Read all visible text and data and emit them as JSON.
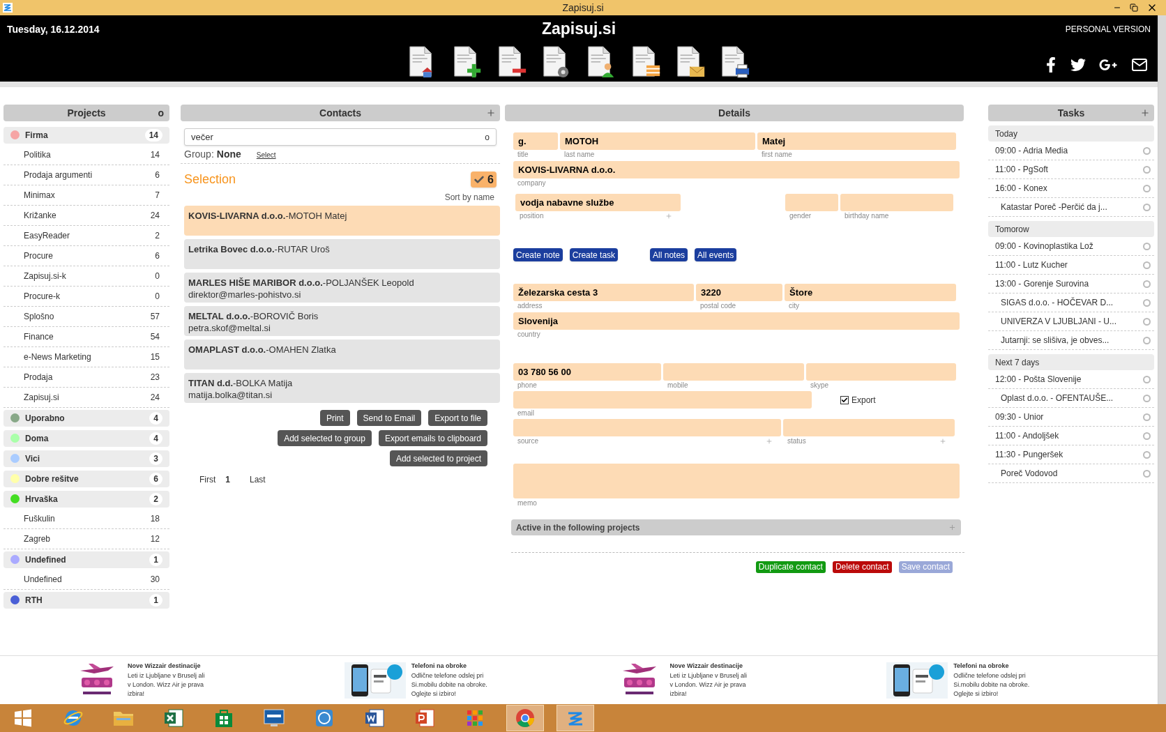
{
  "window": {
    "title": "Zapisuj.si"
  },
  "header": {
    "date": "Tuesday, 16.12.2014",
    "app_title": "Zapisuj.si",
    "edition": "PERSONAL VERSION"
  },
  "projects": {
    "title": "Projects",
    "toggle": "o",
    "groups": [
      {
        "name": "Firma",
        "count": "14",
        "color": "#f6a5a5",
        "children": [
          {
            "name": "Politika",
            "count": "14"
          },
          {
            "name": "Prodaja argumenti",
            "count": "6"
          },
          {
            "name": "Minimax",
            "count": "7"
          },
          {
            "name": "Križanke",
            "count": "24"
          },
          {
            "name": "EasyReader",
            "count": "2"
          },
          {
            "name": "Procure",
            "count": "6"
          },
          {
            "name": "Zapisuj.si-k",
            "count": "0"
          },
          {
            "name": "Procure-k",
            "count": "0"
          },
          {
            "name": "Splošno",
            "count": "57"
          },
          {
            "name": "Finance",
            "count": "54"
          },
          {
            "name": "e-News Marketing",
            "count": "15"
          },
          {
            "name": "Prodaja",
            "count": "23"
          },
          {
            "name": "Zapisuj.si",
            "count": "24"
          }
        ]
      },
      {
        "name": "Uporabno",
        "count": "4",
        "color": "#88a888"
      },
      {
        "name": "Doma",
        "count": "4",
        "color": "#aaffaa"
      },
      {
        "name": "Vici",
        "count": "3",
        "color": "#aaccff"
      },
      {
        "name": "Dobre rešitve",
        "count": "6",
        "color": "#ffffaa"
      },
      {
        "name": "Hrvaška",
        "count": "2",
        "color": "#44dd22",
        "children": [
          {
            "name": "Fuškulin",
            "count": "18"
          },
          {
            "name": "Zagreb",
            "count": "12"
          }
        ]
      },
      {
        "name": "Undefined",
        "count": "1",
        "color": "#aaaaff",
        "children": [
          {
            "name": "Undefined",
            "count": "30"
          }
        ]
      },
      {
        "name": "RTH",
        "count": "1",
        "color": "#4a5fd6"
      }
    ]
  },
  "contacts": {
    "title": "Contacts",
    "search": {
      "value": "večer",
      "count": "o"
    },
    "group_label": "Group:",
    "group_value": "None",
    "group_link": "Select",
    "selection_title": "Selection",
    "selection_count": "6",
    "sort": "Sort by name",
    "items": [
      {
        "company": "KOVIS-LIVARNA d.o.o.",
        "person": "-MOTOH Matej",
        "selected": true
      },
      {
        "company": "Letrika Bovec d.o.o.",
        "person": "-RUTAR Uroš",
        "selected": false
      },
      {
        "company": "MARLES HIŠE MARIBOR d.o.o.",
        "person": "-POLJANŠEK Leopold",
        "email": "direktor@marles-pohistvo.si",
        "selected": false
      },
      {
        "company": "MELTAL d.o.o.",
        "person": "-BOROVIČ Boris",
        "email": "petra.skof@meltal.si",
        "selected": false
      },
      {
        "company": "OMAPLAST d.o.o.",
        "person": "-OMAHEN Zlatka",
        "selected": false
      },
      {
        "company": "TITAN d.d.",
        "person": "-BOLKA Matija",
        "email": "matija.bolka@titan.si",
        "selected": false
      }
    ],
    "actions": [
      [
        "Print",
        "Send to Email",
        "Export to file"
      ],
      [
        "Add selected to group",
        "Export emails to clipboard"
      ],
      [
        "Add selected to project"
      ]
    ],
    "pagination": {
      "first": "First",
      "page": "1",
      "last": "Last"
    }
  },
  "details": {
    "title": "Details",
    "fields": {
      "title": {
        "label": "title",
        "value": "g.",
        "addable": false
      },
      "last_name": {
        "label": "last name",
        "value": "MOTOH",
        "addable": false
      },
      "first_name": {
        "label": "first name",
        "value": "Matej",
        "addable": false
      },
      "company": {
        "label": "company",
        "value": "KOVIS-LIVARNA  d.o.o.",
        "addable": false
      },
      "position": {
        "label": "position",
        "value": "vodja nabavne službe",
        "addable": true
      },
      "gender": {
        "label": "gender",
        "addable": false
      },
      "birthday_name": {
        "label": "birthday name",
        "addable": false
      },
      "address": {
        "label": "address",
        "value": "Železarska cesta 3",
        "addable": false
      },
      "postal_code": {
        "label": "postal code",
        "value": "3220",
        "addable": false
      },
      "city": {
        "label": "city",
        "value": "Štore",
        "addable": false
      },
      "country": {
        "label": "country",
        "value": "Slovenija",
        "addable": false
      },
      "phone": {
        "label": "phone",
        "value": "03 780 56 00",
        "addable": false
      },
      "mobile": {
        "label": "mobile",
        "addable": false
      },
      "skype": {
        "label": "skype",
        "addable": false
      },
      "email": {
        "label": "email",
        "addable": false
      },
      "source": {
        "label": "source",
        "addable": true
      },
      "status": {
        "label": "status",
        "addable": true
      },
      "memo": {
        "label": "memo",
        "addable": false
      }
    },
    "export": {
      "label": "Export",
      "checked": true
    },
    "note_actions": [
      [
        "Create note",
        "Create task"
      ],
      [
        "All notes",
        "All events"
      ]
    ],
    "projects_bar": "Active in the following projects",
    "footer_buttons": [
      {
        "label": "Duplicate contact",
        "kind": "success"
      },
      {
        "label": "Delete contact",
        "kind": "danger"
      },
      {
        "label": "Save contact",
        "kind": "muted"
      }
    ]
  },
  "tasks": {
    "title": "Tasks",
    "groups": [
      {
        "name": "Today",
        "items": [
          {
            "text": "09:00 - Adria Media",
            "kind": "timed",
            "done": false
          },
          {
            "text": "11:00 - PgSoft",
            "kind": "timed",
            "done": false
          },
          {
            "text": "16:00 - Konex",
            "kind": "timed",
            "done": false
          },
          {
            "text": "Katastar Poreč -Perčić da j...",
            "kind": "untimed",
            "done": false
          }
        ]
      },
      {
        "name": "Tomorow",
        "items": [
          {
            "text": "09:00 - Kovinoplastika Lož",
            "kind": "timed",
            "done": false
          },
          {
            "text": "11:00 - Lutz Kucher",
            "kind": "timed",
            "done": false
          },
          {
            "text": "13:00 - Gorenje Surovina",
            "kind": "timed",
            "done": false
          },
          {
            "text": "SIGAS d.o.o. - HOČEVAR D...",
            "kind": "untimed",
            "done": false
          },
          {
            "text": "UNIVERZA V LJUBLJANI - U...",
            "kind": "untimed",
            "done": false
          },
          {
            "text": "Jutarnji: se slišiva, je obves...",
            "kind": "untimed",
            "done": false
          }
        ]
      },
      {
        "name": "Next 7 days",
        "items": [
          {
            "text": "12:00 - Pošta Slovenije",
            "kind": "timed",
            "done": false
          },
          {
            "text": "Oplast d.o.o. - OFENTAUŠE...",
            "kind": "untimed",
            "done": false
          },
          {
            "text": "09:30 - Unior",
            "kind": "timed",
            "done": false
          },
          {
            "text": "11:00 - Andoljšek",
            "kind": "timed",
            "done": false
          },
          {
            "text": "11:30 - Pungeršek",
            "kind": "timed",
            "done": false
          },
          {
            "text": "Poreč Vodovod",
            "kind": "untimed",
            "done": false
          }
        ]
      }
    ]
  },
  "ads": [
    {
      "kind": "airline",
      "title": "Nove Wizzair destinacije",
      "lines": [
        "Leti iz Ljubljane v Bruselj ali",
        "v London. Wizz Air je prava",
        "izbira!"
      ]
    },
    {
      "kind": "phone",
      "title": "Telefoni na obroke",
      "lines": [
        "Odlične telefone odslej pri",
        "Si.mobilu dobite na obroke.",
        "Oglejte si izbiro!"
      ]
    },
    {
      "kind": "airline",
      "title": "Nove Wizzair destinacije",
      "lines": [
        "Leti iz Ljubljane v Bruselj ali",
        "v London. Wizz Air je prava",
        "izbira!"
      ]
    },
    {
      "kind": "phone",
      "title": "Telefoni na obroke",
      "lines": [
        "Odlične telefone odslej pri",
        "Si.mobilu dobite na obroke.",
        "Oglejte si izbiro!"
      ]
    }
  ],
  "taskbar": [
    {
      "kind": "start",
      "active": false
    },
    {
      "kind": "browser",
      "active": false
    },
    {
      "kind": "folder",
      "active": false
    },
    {
      "kind": "sheet",
      "active": false
    },
    {
      "kind": "store",
      "active": false
    },
    {
      "kind": "monitor",
      "active": false
    },
    {
      "kind": "chip",
      "active": false
    },
    {
      "kind": "doc",
      "active": false
    },
    {
      "kind": "slides",
      "active": false
    },
    {
      "kind": "grid",
      "active": false
    },
    {
      "kind": "chrome",
      "active": true
    },
    {
      "kind": "app",
      "active": true
    }
  ]
}
